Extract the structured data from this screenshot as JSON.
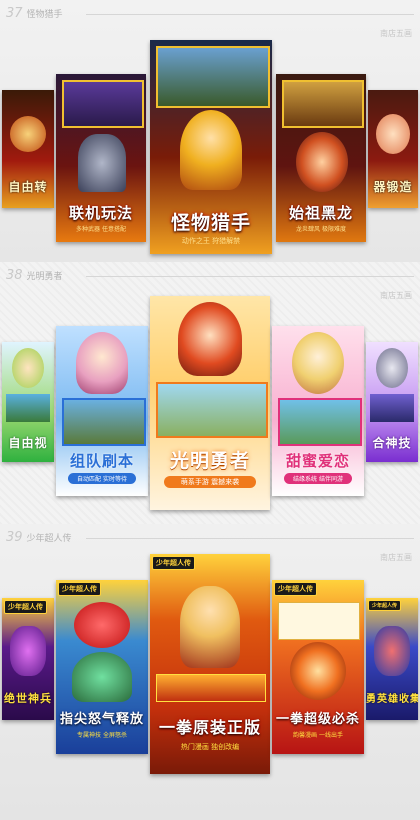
{
  "sections": [
    {
      "number": "37",
      "title": "怪物猎手",
      "brand": "南店五画",
      "cards": [
        {
          "caption": "自由转",
          "sub": "",
          "theme": "#a11a0e"
        },
        {
          "caption": "联机玩法",
          "sub": "多种武器 任意搭配",
          "theme": "#6b1410"
        },
        {
          "caption": "怪物猎手",
          "sub": "动作之王 狩猎解禁",
          "theme": "#7a1c08"
        },
        {
          "caption": "始祖黑龙",
          "sub": "龙炎肆风 极限难度",
          "theme": "#5f1410"
        },
        {
          "caption": "器锻造",
          "sub": "",
          "theme": "#8c1a10"
        }
      ]
    },
    {
      "number": "38",
      "title": "光明勇者",
      "brand": "南店五画",
      "cards": [
        {
          "caption": "自由视",
          "sub": "",
          "theme": "#2fb13f"
        },
        {
          "caption": "组队刷本",
          "sub": "自动匹配 实时等待",
          "theme": "#2a6fd6"
        },
        {
          "caption": "光明勇者",
          "sub": "萌系手游 震撼来袭",
          "theme": "#f07a1c"
        },
        {
          "caption": "甜蜜爱恋",
          "sub": "结缘系统 结伴同游",
          "theme": "#e0317a"
        },
        {
          "caption": "合神技",
          "sub": "",
          "theme": "#7a2ed0"
        }
      ]
    },
    {
      "number": "39",
      "title": "少年超人传",
      "brand": "南店五画",
      "cards": [
        {
          "caption": "绝世神兵",
          "sub": "",
          "badge": "少年超人传",
          "theme": "#5a1a8a"
        },
        {
          "caption": "指尖怒气释放",
          "sub": "专属神技 全屏怒杀",
          "badge": "少年超人传",
          "theme": "#1a3f9a"
        },
        {
          "caption": "一拳原装正版",
          "sub": "热门漫画 独创改编",
          "badge": "少年超人传",
          "theme": "#c4300c"
        },
        {
          "caption": "一拳超级必杀",
          "sub": "韵馨漫画 一线出手",
          "badge": "少年超人传",
          "theme": "#b71414"
        },
        {
          "caption": "勇英雄收集",
          "sub": "",
          "badge": "少年超人传",
          "theme": "#2a3aa8"
        }
      ]
    }
  ]
}
